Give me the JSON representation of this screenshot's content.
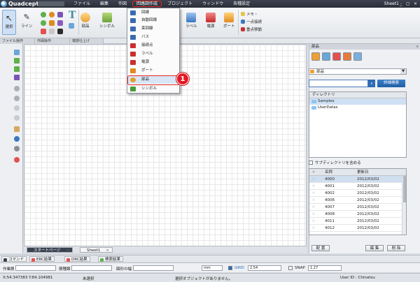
{
  "app": {
    "logo_text": "Quadcept",
    "window_title": "Sheet1 - ",
    "window_controls": "_ ◻ ×"
  },
  "menubar": {
    "items": [
      "ファイル",
      "編集",
      "作図",
      "回路図作成",
      "プロジェクト",
      "ウィンドウ",
      "各種設定"
    ],
    "active_index": 3
  },
  "ribbon": {
    "select_label": "選択",
    "line_label": "ライン",
    "part_label": "部品",
    "symbol_label": "シンボル",
    "label_label": "ラベル",
    "power_label": "電源",
    "port_label": "ポート",
    "memo_label": "メモ・",
    "one_point_wire_label": "一点接続",
    "vertex_move_label": "重点移動",
    "groups": [
      "ファイル操作",
      "作図操作",
      "端部仕上げ"
    ]
  },
  "dropdown": {
    "items": [
      {
        "label": "回線",
        "icon": "wire-icon",
        "color": "#3a6bb0"
      },
      {
        "label": "自動回線",
        "icon": "auto-wire-icon",
        "color": "#3a6bb0"
      },
      {
        "label": "束回線",
        "icon": "bundle-wire-icon",
        "color": "#3a6bb0"
      },
      {
        "label": "バス",
        "icon": "bus-icon",
        "color": "#3a6bb0"
      },
      {
        "label": "接続点",
        "icon": "junction-icon",
        "color": "#c83030"
      },
      {
        "label": "ラベル",
        "icon": "label-icon",
        "color": "#c83030"
      },
      {
        "label": "電源",
        "icon": "power-icon",
        "color": "#c83030"
      },
      {
        "label": "ポート",
        "icon": "port-icon",
        "color": "#e08a20"
      },
      {
        "label": "部品",
        "icon": "part-icon",
        "color": "#e0a030"
      },
      {
        "label": "シンボル",
        "icon": "symbol-icon",
        "color": "#4a9a3a"
      }
    ],
    "highlighted_index": 8
  },
  "callout": {
    "number": "1"
  },
  "canvas_tabs": [
    {
      "label": "スタートページ",
      "dark": true
    },
    {
      "label": "Sheet1",
      "dark": false
    }
  ],
  "panel": {
    "title": "部品",
    "pin": "»",
    "category_select": "部品",
    "search_button": "詳細検索",
    "directory_header": "ディレクトリ",
    "directories": [
      "Samples",
      "UserDatas"
    ],
    "include_subdirs_label": "サブディレクトリを含める",
    "table_headers": {
      "star": "★",
      "name": "名称",
      "date": "更新日"
    },
    "rows": [
      {
        "name": "4000",
        "date": "2012/03/02"
      },
      {
        "name": "4001",
        "date": "2012/03/02"
      },
      {
        "name": "4002",
        "date": "2012/03/02"
      },
      {
        "name": "4006",
        "date": "2012/03/02"
      },
      {
        "name": "4007",
        "date": "2012/03/02"
      },
      {
        "name": "4008",
        "date": "2012/03/02"
      },
      {
        "name": "4011",
        "date": "2012/03/02"
      },
      {
        "name": "4012",
        "date": "2012/03/02"
      }
    ],
    "place_button": "配 置",
    "edit_button": "編 集",
    "delete_button": "削 除"
  },
  "bottom_tabs": [
    "コマンド",
    "ERC結果",
    "DRC結果",
    "検索結果"
  ],
  "property_bar": {
    "layer_label": "作業層",
    "linetype_label": "層種類",
    "rotation_label": "図形の幅",
    "unit": "mm",
    "grid_label": "GRID",
    "grid_value": "2.54",
    "snap_label": "SNAP",
    "snap_value": "1.27"
  },
  "status": {
    "coords": "X:54.347383  Y:84.104981",
    "mode": "未選択",
    "message": "選択オブジェクトがありません。",
    "user": "User ID : Chinatsu"
  }
}
